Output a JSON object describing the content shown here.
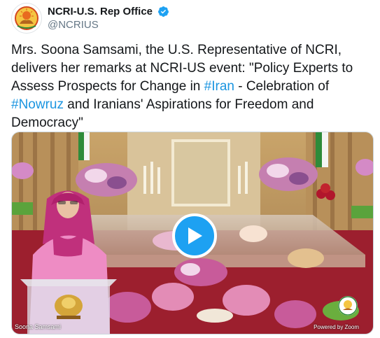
{
  "account": {
    "display_name": "NCRI-U.S. Rep Office",
    "handle": "@NCRIUS",
    "verified": true,
    "avatar_icon": "ncri-lion-sun-logo-icon"
  },
  "tweet": {
    "text_part1": "Mrs. Soona Samsami, the U.S. Representative of NCRI, delivers her remarks at NCRI-US event: \"Policy Experts to Assess Prospects for Change in ",
    "hashtag1": "#Iran",
    "text_part2": " - Celebration of ",
    "hashtag2": "#Nowruz",
    "text_part3": " and Iranians' Aspirations for Freedom and Democracy\""
  },
  "media": {
    "type": "video",
    "play_icon": "play-icon",
    "speaker_caption": "Soona Samsami",
    "powered_by": "Powered by Zoom"
  },
  "colors": {
    "link": "#1b95e0",
    "play_button": "#1da1f2",
    "verified": "#1da1f2"
  }
}
